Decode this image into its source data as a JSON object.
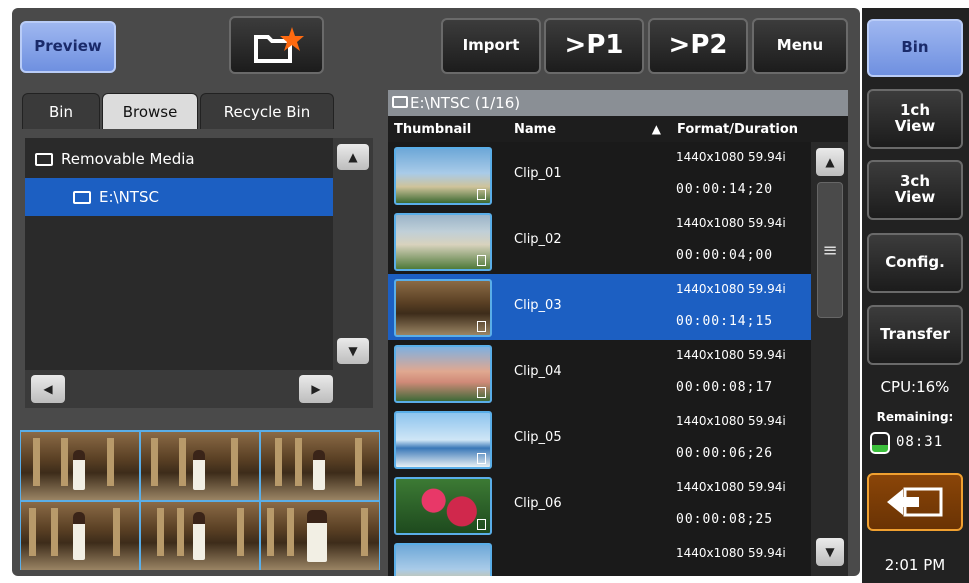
{
  "toolbar": {
    "preview_label": "Preview",
    "import_label": "Import",
    "p1_label": ">P1",
    "p2_label": ">P2",
    "menu_label": "Menu"
  },
  "tabs": [
    {
      "label": "Bin"
    },
    {
      "label": "Browse"
    },
    {
      "label": "Recycle Bin"
    }
  ],
  "active_tab": "Browse",
  "tree": {
    "items": [
      {
        "label": "Removable Media"
      },
      {
        "label": "E:\\NTSC"
      }
    ]
  },
  "list": {
    "header": "E:\\NTSC (1/16)",
    "columns": [
      "Thumbnail",
      "Name",
      "Format/Duration"
    ],
    "clips": [
      {
        "name": "Clip_01",
        "format": "1440x1080 59.94i",
        "duration": "00:00:14;20",
        "thumb": "beach-palm",
        "selected": false
      },
      {
        "name": "Clip_02",
        "format": "1440x1080 59.94i",
        "duration": "00:00:04;00",
        "thumb": "sign",
        "selected": false
      },
      {
        "name": "Clip_03",
        "format": "1440x1080 59.94i",
        "duration": "00:00:14;15",
        "thumb": "hall",
        "selected": true
      },
      {
        "name": "Clip_04",
        "format": "1440x1080 59.94i",
        "duration": "00:00:08;17",
        "thumb": "hotel",
        "selected": false
      },
      {
        "name": "Clip_05",
        "format": "1440x1080 59.94i",
        "duration": "00:00:06;26",
        "thumb": "sea",
        "selected": false
      },
      {
        "name": "Clip_06",
        "format": "1440x1080 59.94i",
        "duration": "00:00:08;25",
        "thumb": "flowers",
        "selected": false
      },
      {
        "name": "",
        "format": "1440x1080 59.94i",
        "duration": "",
        "thumb": "beach-palm",
        "selected": false
      }
    ]
  },
  "sidebar": {
    "bin_label": "Bin",
    "view1_label": "1ch View",
    "view3_label": "3ch View",
    "config_label": "Config.",
    "transfer_label": "Transfer",
    "cpu": "CPU:16%",
    "remaining_label": "Remaining:",
    "remaining_value": "08:31",
    "clock": "2:01 PM"
  },
  "colors": {
    "selection": "#1c5fc2",
    "accent_blue": "#7f9ce6",
    "thumb_border": "#5aaee8",
    "exit_border": "#f0a030"
  }
}
